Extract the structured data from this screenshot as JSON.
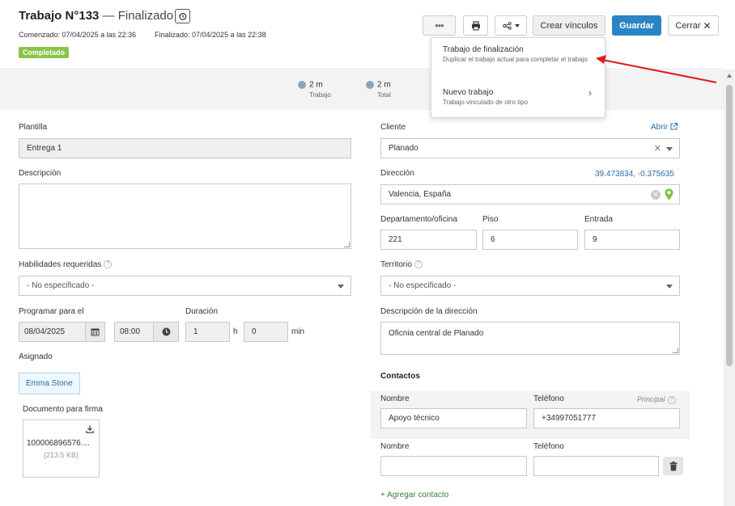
{
  "header": {
    "title_number": "Trabajo N°133",
    "title_separator": "—",
    "title_state": "Finalizado",
    "started": "Comenzado: 07/04/2025 a las 22:36",
    "finished": "Finalizado: 07/04/2025 a las 22:38",
    "status_badge": "Completado"
  },
  "toolbar": {
    "more_label": "•••",
    "create_links_label": "Crear vínculos",
    "save_label": "Guardar",
    "close_label": "Cerrar"
  },
  "stats": [
    {
      "value": "2 m",
      "label": "Trabajo"
    },
    {
      "value": "2 m",
      "label": "Total"
    }
  ],
  "dropdown": {
    "items": [
      {
        "title": "Trabajo de finalización",
        "description": "Duplicar el trabajo actual para completar el trabajo"
      },
      {
        "title": "Nuevo trabajo",
        "description": "Trabajo vinculado de otro tipo"
      }
    ]
  },
  "left": {
    "template_label": "Plantilla",
    "template_value": "Entrega 1",
    "description_label": "Descripción",
    "skills_label": "Habilidades requeridas",
    "skills_value": "- No especificado -",
    "schedule_label": "Programar para el",
    "schedule_date": "08/04/2025",
    "schedule_time": "08:00",
    "duration_label": "Duración",
    "duration_hours": "1",
    "hours_unit": "h",
    "duration_minutes": "0",
    "minutes_unit": "min",
    "assigned_label": "Asignado",
    "assignee": "Emma Stone",
    "signature_doc_label": "Documento para firma",
    "doc_name": "100006896576....",
    "doc_size": "(213.5 KB)"
  },
  "right": {
    "client_label": "Cliente",
    "open_link": "Abrir",
    "client_value": "Planado",
    "address_label": "Dirección",
    "coordinates": "39.473834, -0.375635",
    "address_value": "Valencia, España",
    "department_label": "Departamento/oficina",
    "department_value": "221",
    "floor_label": "Piso",
    "floor_value": "6",
    "entrance_label": "Entrada",
    "entrance_value": "9",
    "territory_label": "Territorio",
    "territory_value": "- No especificado -",
    "address_desc_label": "Descripción de la dirección",
    "address_desc_value": "Oficnia central de Planado",
    "contacts_label": "Contactos",
    "name_label": "Nombre",
    "phone_label": "Teléfono",
    "principal_label": "Principal",
    "contact1_name": "Apoyo técnico",
    "contact1_phone": "+34997051777",
    "add_contact": "+ Agregar contacto"
  },
  "colors": {
    "accent": "#2a84c6",
    "badge": "#8bc34a",
    "annotation_arrow": "#e01b1b",
    "map_pin": "#7cc142"
  }
}
